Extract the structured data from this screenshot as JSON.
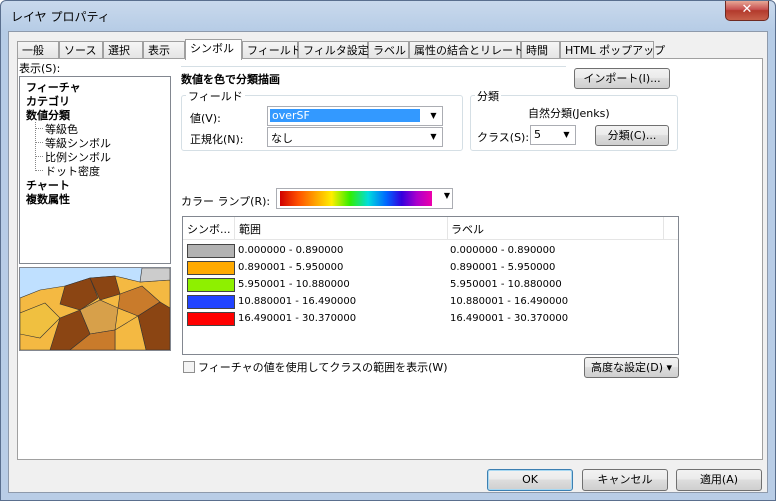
{
  "window": {
    "title": "レイヤ プロパティ",
    "close_glyph": "✕"
  },
  "tabs": [
    "一般",
    "ソース",
    "選択",
    "表示",
    "シンボル",
    "フィールド",
    "フィルタ設定",
    "ラベル",
    "属性の結合とリレート",
    "時間",
    "HTML ポップアップ"
  ],
  "active_tab": "シンボル",
  "show": {
    "label": "表示(S):",
    "items": [
      {
        "label": "フィーチャ",
        "bold": true
      },
      {
        "label": "カテゴリ",
        "bold": true
      },
      {
        "label": "数値分類",
        "bold": true
      },
      {
        "label": "等級色",
        "bold": false
      },
      {
        "label": "等級シンボル",
        "bold": false
      },
      {
        "label": "比例シンボル",
        "bold": false
      },
      {
        "label": "ドット密度",
        "bold": false
      },
      {
        "label": "チャート",
        "bold": true
      },
      {
        "label": "複数属性",
        "bold": true
      }
    ]
  },
  "main": {
    "heading": "数値を色で分類描画",
    "import_button": "インポート(I)...",
    "field_group": {
      "title": "フィールド",
      "value_label": "値(V):",
      "value_selected": "overSF",
      "normalize_label": "正規化(N):",
      "normalize_value": "なし"
    },
    "classify_group": {
      "title": "分類",
      "method": "自然分類(Jenks)",
      "class_label": "クラス(S):",
      "class_value": "5",
      "classify_button": "分類(C)..."
    },
    "color_ramp_label": "カラー ランプ(R):",
    "table": {
      "headers": [
        "シンボ...",
        "範囲",
        "ラベル"
      ],
      "rows": [
        {
          "color": "#b2b2b2",
          "range": "0.000000 - 0.890000",
          "label": "0.000000 - 0.890000"
        },
        {
          "color": "#ffaa00",
          "range": "0.890001 - 5.950000",
          "label": "0.890001 - 5.950000"
        },
        {
          "color": "#8ef000",
          "range": "5.950001 - 10.880000",
          "label": "5.950001 - 10.880000"
        },
        {
          "color": "#2244ff",
          "range": "10.880001 - 16.490000",
          "label": "10.880001 - 16.490000"
        },
        {
          "color": "#ff0000",
          "range": "16.490001 - 30.370000",
          "label": "16.490001 - 30.370000"
        }
      ]
    },
    "checkbox_label": "フィーチャの値を使用してクラスの範囲を表示(W)",
    "advanced_button": "高度な設定(D) ▾"
  },
  "footer": {
    "ok": "OK",
    "cancel": "キャンセル",
    "apply": "適用(A)"
  },
  "colors": {
    "selection": "#3399ff",
    "title_gradient": "#b9cde6"
  }
}
